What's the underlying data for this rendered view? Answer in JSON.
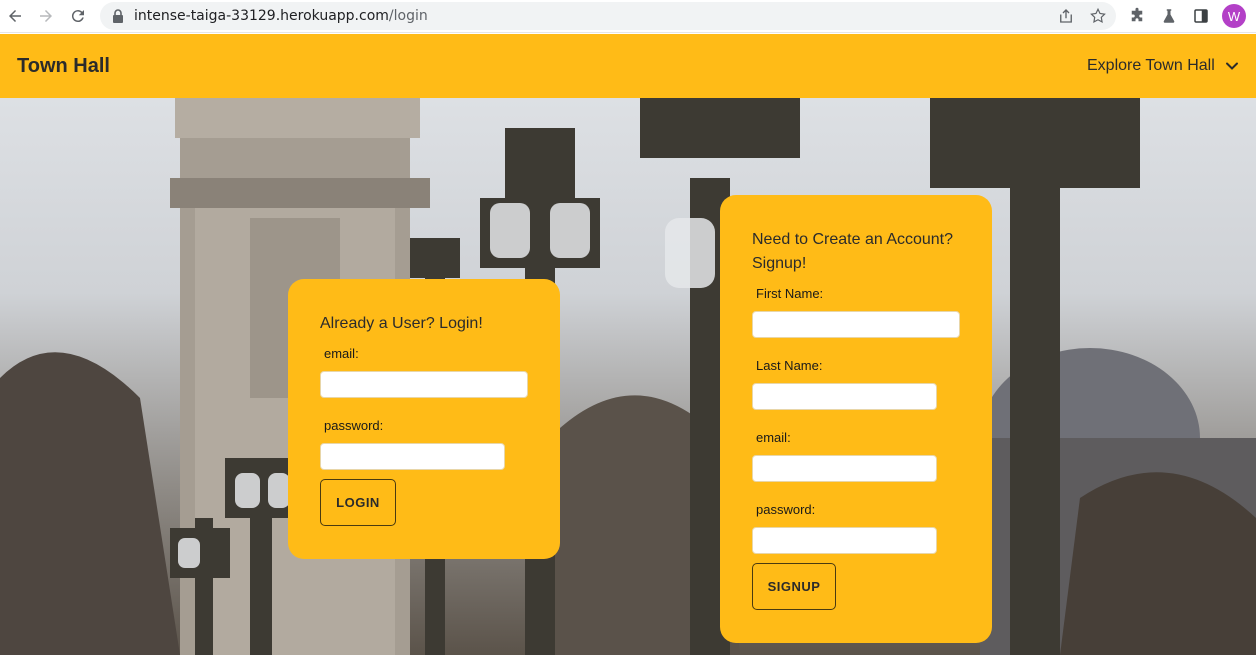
{
  "browser": {
    "url_host": "intense-taiga-33129.herokuapp.com",
    "url_path": "/login",
    "profile_initial": "W"
  },
  "navbar": {
    "brand": "Town Hall",
    "explore_label": "Explore Town Hall"
  },
  "login_card": {
    "title": "Already a User? Login!",
    "email_label": "email:",
    "password_label": "password:",
    "email_value": "",
    "password_value": "",
    "button_label": "LOGIN"
  },
  "signup_card": {
    "title_line1": "Need to Create an Account?",
    "title_line2": "Signup!",
    "first_name_label": "First Name:",
    "last_name_label": "Last Name:",
    "email_label": "email:",
    "password_label": "password:",
    "first_name_value": "",
    "last_name_value": "",
    "email_value": "",
    "password_value": "",
    "button_label": "SIGNUP"
  },
  "colors": {
    "accent": "#ffbb17",
    "text": "#2b2b2b"
  }
}
